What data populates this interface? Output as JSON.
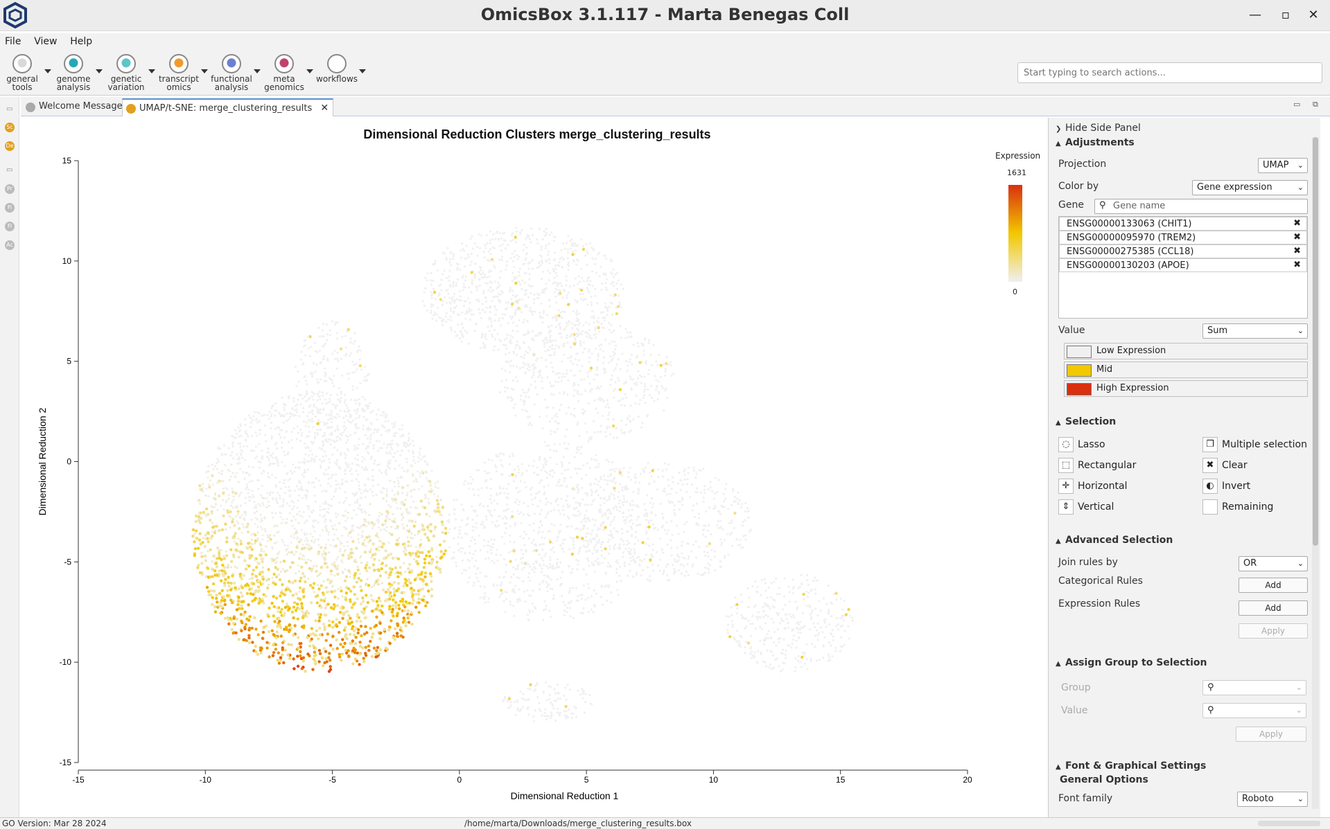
{
  "window": {
    "title": "OmicsBox 3.1.117 - Marta Benegas Coll",
    "minimize": "—",
    "maximize": "▫",
    "close": "✕"
  },
  "menu": [
    "File",
    "View",
    "Help"
  ],
  "toolbar": {
    "tools": [
      {
        "line1": "general",
        "line2": "tools",
        "color": "#d9d9d9",
        "icon": "general-tools-icon"
      },
      {
        "line1": "genome",
        "line2": "analysis",
        "color": "#27a7b5",
        "icon": "genome-analysis-icon"
      },
      {
        "line1": "genetic",
        "line2": "variation",
        "color": "#5cc6c8",
        "icon": "genetic-variation-icon"
      },
      {
        "line1": "transcript",
        "line2": "omics",
        "color": "#f09a2c",
        "icon": "transcriptomics-icon"
      },
      {
        "line1": "functional",
        "line2": "analysis",
        "color": "#6b7fd0",
        "icon": "functional-analysis-icon"
      },
      {
        "line1": "meta",
        "line2": "genomics",
        "color": "#c2416b",
        "icon": "metagenomics-icon"
      },
      {
        "line1": "workflows",
        "line2": "",
        "color": "#ffffff",
        "icon": "workflows-icon"
      }
    ],
    "search_placeholder": "Start typing to search actions..."
  },
  "tabs": [
    {
      "label": "Welcome Message",
      "icon": "We",
      "active": false
    },
    {
      "label": "UMAP/t-SNE: merge_clustering_results",
      "icon": "Sc",
      "active": true,
      "close": "✕"
    }
  ],
  "left_strip_icons": [
    "Sc",
    "De",
    "Pr",
    "Fi",
    "Fi",
    "Ac"
  ],
  "plot": {
    "title": "Dimensional Reduction Clusters merge_clustering_results",
    "xlabel": "Dimensional Reduction 1",
    "ylabel": "Dimensional Reduction 2",
    "legend_title": "Expression",
    "legend_max": "1631",
    "legend_min": "0"
  },
  "chart_data": {
    "type": "scatter",
    "title": "Dimensional Reduction Clusters merge_clustering_results",
    "xlabel": "Dimensional Reduction 1",
    "ylabel": "Dimensional Reduction 2",
    "xlim": [
      -15,
      20
    ],
    "ylim": [
      -15,
      15
    ],
    "xticks": [
      -15,
      -10,
      -5,
      0,
      5,
      10,
      15,
      20
    ],
    "yticks": [
      15,
      10,
      5,
      0,
      -5,
      -10,
      -15
    ],
    "color_scale": {
      "name": "Expression",
      "min": 0,
      "max": 1631,
      "colors": [
        "#f0f0f0",
        "#f2c800",
        "#d9300f"
      ]
    },
    "clusters": [
      {
        "cx": -5.5,
        "cy": -3.5,
        "rx": 5.0,
        "ry": 7.0,
        "n": 2600,
        "expr": "high-bottom"
      },
      {
        "cx": 2.5,
        "cy": 8.5,
        "rx": 4.0,
        "ry": 3.2,
        "n": 900,
        "expr": "low"
      },
      {
        "cx": 5.0,
        "cy": 4.0,
        "rx": 3.5,
        "ry": 3.0,
        "n": 500,
        "expr": "low"
      },
      {
        "cx": 3.5,
        "cy": -3.5,
        "rx": 4.0,
        "ry": 4.5,
        "n": 900,
        "expr": "low"
      },
      {
        "cx": 8.0,
        "cy": -3.0,
        "rx": 3.5,
        "ry": 3.0,
        "n": 500,
        "expr": "low"
      },
      {
        "cx": 13.0,
        "cy": -8.0,
        "rx": 2.5,
        "ry": 2.5,
        "n": 350,
        "expr": "low"
      },
      {
        "cx": 3.5,
        "cy": -12.0,
        "rx": 1.8,
        "ry": 1.0,
        "n": 120,
        "expr": "low"
      },
      {
        "cx": -5.0,
        "cy": 4.0,
        "rx": 1.5,
        "ry": 3.0,
        "n": 200,
        "expr": "low"
      }
    ]
  },
  "side_panel": {
    "hide_label": "Hide Side Panel",
    "adjustments": {
      "title": "Adjustments",
      "projection_label": "Projection",
      "projection_value": "UMAP",
      "colorby_label": "Color by",
      "colorby_value": "Gene expression",
      "gene_label": "Gene",
      "gene_placeholder": "Gene name",
      "genes": [
        "ENSG00000133063 (CHIT1)",
        "ENSG00000095970 (TREM2)",
        "ENSG00000275385 (CCL18)",
        "ENSG00000130203 (APOE)"
      ],
      "remove_glyph": "✖",
      "value_label": "Value",
      "value_value": "Sum",
      "colors": [
        {
          "label": "Low Expression",
          "color": "#f0f0f0"
        },
        {
          "label": "Mid",
          "color": "#f2c800"
        },
        {
          "label": "High Expression",
          "color": "#d9300f"
        }
      ]
    },
    "selection": {
      "title": "Selection",
      "items": [
        {
          "label": "Lasso",
          "glyph": "◌",
          "icon": "lasso-icon"
        },
        {
          "label": "Multiple selection",
          "glyph": "❐",
          "icon": "multiple-selection-icon"
        },
        {
          "label": "Rectangular",
          "glyph": "⬚",
          "icon": "rectangular-icon"
        },
        {
          "label": "Clear",
          "glyph": "✖",
          "icon": "clear-icon"
        },
        {
          "label": "Horizontal",
          "glyph": "✛",
          "icon": "horizontal-icon"
        },
        {
          "label": "Invert",
          "glyph": "◐",
          "icon": "invert-icon"
        },
        {
          "label": "Vertical",
          "glyph": "⇕",
          "icon": "vertical-icon"
        },
        {
          "label": "Remaining",
          "glyph": "",
          "icon": "remaining-icon"
        }
      ]
    },
    "advanced": {
      "title": "Advanced Selection",
      "join_label": "Join rules by",
      "join_value": "OR",
      "categorical_label": "Categorical Rules",
      "expression_label": "Expression Rules",
      "add_label": "Add",
      "apply_label": "Apply"
    },
    "assign": {
      "title": "Assign Group to Selection",
      "group_label": "Group",
      "value_label": "Value",
      "apply_label": "Apply"
    },
    "font": {
      "title": "Font & Graphical Settings",
      "general": "General Options",
      "family_label": "Font family",
      "family_value": "Roboto"
    }
  },
  "status": {
    "left": "GO Version: Mar 28 2024",
    "center": "/home/marta/Downloads/merge_clustering_results.box"
  }
}
